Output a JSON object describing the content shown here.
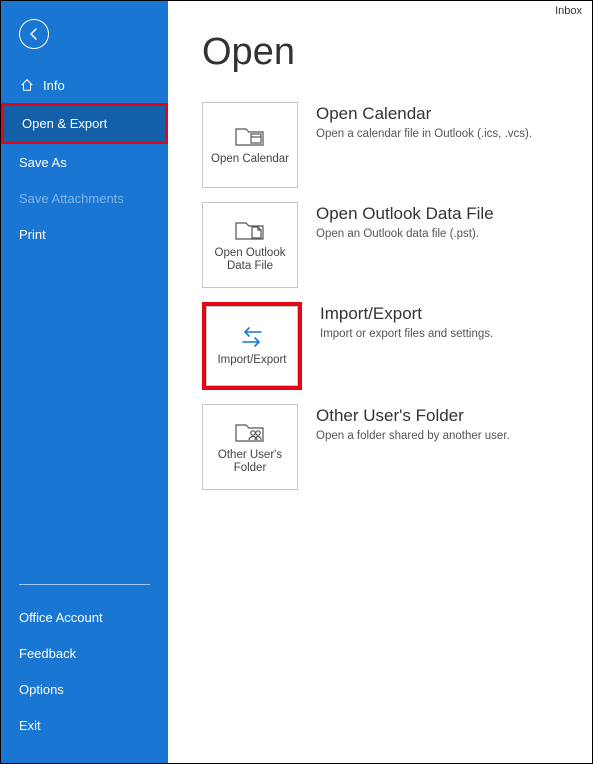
{
  "header": {
    "inbox_label": "Inbox"
  },
  "sidebar": {
    "info": "Info",
    "open_export": "Open & Export",
    "save_as": "Save As",
    "save_attachments": "Save Attachments",
    "print": "Print",
    "office_account": "Office Account",
    "feedback": "Feedback",
    "options": "Options",
    "exit": "Exit"
  },
  "page": {
    "title": "Open",
    "options": {
      "open_calendar": {
        "tile": "Open Calendar",
        "title": "Open Calendar",
        "desc": "Open a calendar file in Outlook (.ics, .vcs)."
      },
      "open_data_file": {
        "tile": "Open Outlook Data File",
        "title": "Open Outlook Data File",
        "desc": "Open an Outlook data file (.pst)."
      },
      "import_export": {
        "tile": "Import/Export",
        "title": "Import/Export",
        "desc": "Import or export files and settings."
      },
      "other_user": {
        "tile": "Other User's Folder",
        "title": "Other User's Folder",
        "desc": "Open a folder shared by another user."
      }
    }
  }
}
